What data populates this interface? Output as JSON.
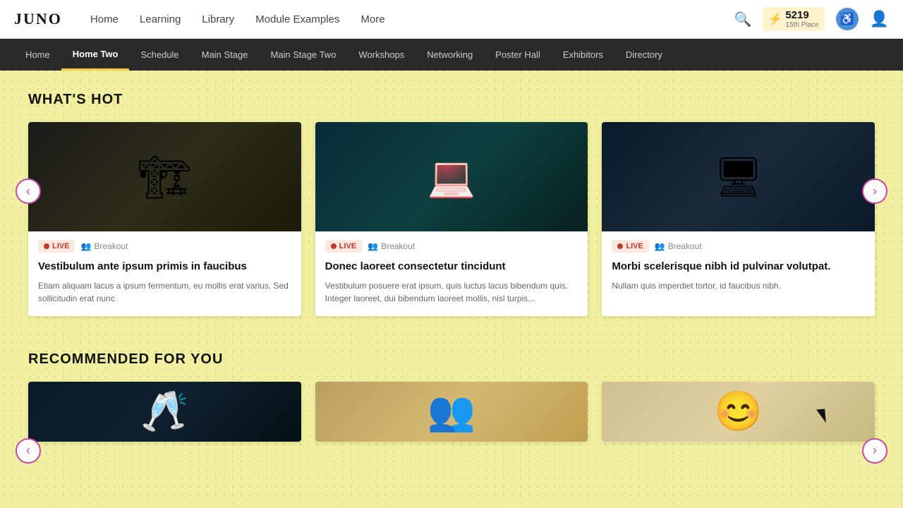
{
  "logo": {
    "text": "JUNO"
  },
  "topNav": {
    "links": [
      {
        "label": "Home",
        "active": false
      },
      {
        "label": "Learning",
        "active": false
      },
      {
        "label": "Library",
        "active": false
      },
      {
        "label": "Module Examples",
        "active": false
      },
      {
        "label": "More",
        "active": false
      }
    ]
  },
  "points": {
    "icon": "⚡",
    "number": "5219",
    "sub": "15th Place"
  },
  "subNav": {
    "links": [
      {
        "label": "Home",
        "active": false
      },
      {
        "label": "Home Two",
        "active": true
      },
      {
        "label": "Schedule",
        "active": false
      },
      {
        "label": "Main Stage",
        "active": false
      },
      {
        "label": "Main Stage Two",
        "active": false
      },
      {
        "label": "Workshops",
        "active": false
      },
      {
        "label": "Networking",
        "active": false
      },
      {
        "label": "Poster Hall",
        "active": false
      },
      {
        "label": "Exhibitors",
        "active": false
      },
      {
        "label": "Directory",
        "active": false
      }
    ]
  },
  "whatsHot": {
    "title": "WHAT'S HOT",
    "cards": [
      {
        "imageType": "crane",
        "liveLabel": "LIVE",
        "breakoutLabel": "Breakout",
        "title": "Vestibulum ante ipsum primis in faucibus",
        "desc": "Etiam aliquam lacus a ipsum fermentum, eu mollis erat varius. Sed sollicitudin erat nunc"
      },
      {
        "imageType": "computer",
        "liveLabel": "LIVE",
        "breakoutLabel": "Breakout",
        "title": "Donec laoreet consectetur tincidunt",
        "desc": "Vestibulum posuere erat ipsum, quis luctus lacus bibendum quis. Integer laoreet, dui bibendum laoreet mollis, nisl turpis..."
      },
      {
        "imageType": "screen",
        "liveLabel": "LIVE",
        "breakoutLabel": "Breakout",
        "title": "Morbi scelerisque nibh id pulvinar volutpat.",
        "desc": "Nullam quis imperdiet tortor, id faucibus nibh."
      }
    ],
    "prevBtn": "‹",
    "nextBtn": "›"
  },
  "recommended": {
    "title": "RECOMMENDED FOR YOU",
    "cards": [
      {
        "imageType": "glasses"
      },
      {
        "imageType": "group"
      },
      {
        "imageType": "person"
      }
    ],
    "prevBtn": "‹",
    "nextBtn": "›"
  }
}
